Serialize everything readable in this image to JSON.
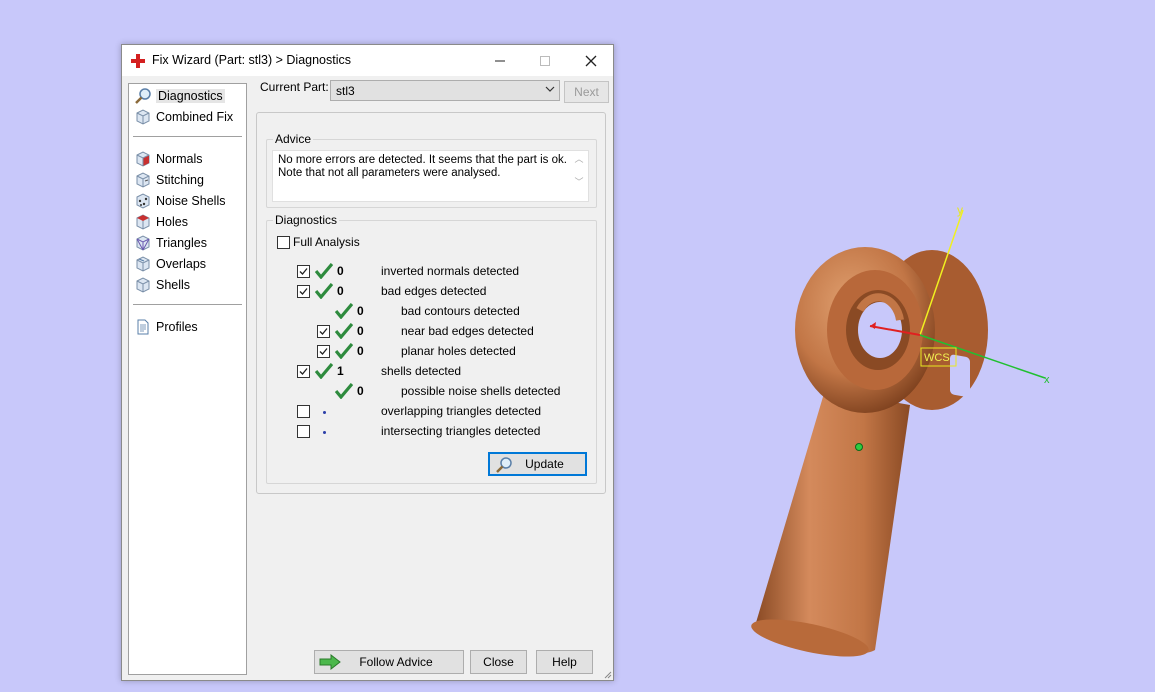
{
  "window": {
    "title": "Fix Wizard (Part: stl3) > Diagnostics",
    "minimize": "—",
    "maximize": "☐",
    "close": "✕"
  },
  "nav": {
    "items": [
      {
        "label": "Diagnostics",
        "icon": "magnifier-icon",
        "selected": true
      },
      {
        "label": "Combined Fix",
        "icon": "cube-icon"
      },
      {
        "label": "Normals",
        "icon": "normals-cube-icon"
      },
      {
        "label": "Stitching",
        "icon": "stitching-cube-icon"
      },
      {
        "label": "Noise Shells",
        "icon": "noise-shells-icon"
      },
      {
        "label": "Holes",
        "icon": "holes-cube-icon"
      },
      {
        "label": "Triangles",
        "icon": "triangles-icon"
      },
      {
        "label": "Overlaps",
        "icon": "overlaps-icon"
      },
      {
        "label": "Shells",
        "icon": "shells-icon"
      },
      {
        "label": "Profiles",
        "icon": "document-icon"
      }
    ]
  },
  "header": {
    "current_part_label": "Current Part:",
    "current_part_value": "stl3",
    "next_label": "Next"
  },
  "advice": {
    "legend": "Advice",
    "text_line1": "No more errors are detected. It seems that the part is ok.",
    "text_line2": "Note that not all parameters were analysed."
  },
  "diagnostics": {
    "legend": "Diagnostics",
    "full_analysis_label": "Full Analysis",
    "full_analysis_checked": false,
    "rows": [
      {
        "label": "inverted normals detected",
        "count": "0",
        "checked": true,
        "status": "ok",
        "indent": 0
      },
      {
        "label": "bad edges detected",
        "count": "0",
        "checked": true,
        "status": "ok",
        "indent": 0
      },
      {
        "label": "bad contours detected",
        "count": "0",
        "checkbox": false,
        "status": "ok",
        "indent": 1
      },
      {
        "label": "near bad edges detected",
        "count": "0",
        "checked": true,
        "status": "ok",
        "indent": 1
      },
      {
        "label": "planar holes detected",
        "count": "0",
        "checked": true,
        "status": "ok",
        "indent": 1
      },
      {
        "label": "shells detected",
        "count": "1",
        "checked": true,
        "status": "ok",
        "indent": 0
      },
      {
        "label": "possible noise shells detected",
        "count": "0",
        "checkbox": false,
        "status": "ok",
        "indent": 1
      },
      {
        "label": "overlapping triangles detected",
        "count": "",
        "checked": false,
        "status": "pending",
        "indent": 0
      },
      {
        "label": "intersecting triangles detected",
        "count": "",
        "checked": false,
        "status": "pending",
        "indent": 0
      }
    ],
    "update_label": "Update"
  },
  "footer": {
    "follow_advice_label": "Follow Advice",
    "close_label": "Close",
    "help_label": "Help"
  },
  "viewport": {
    "wcs_label": "WCS",
    "axis_y": "y",
    "axis_x": "x",
    "background": "#c8c8fa",
    "part_color": "#c8784a"
  }
}
